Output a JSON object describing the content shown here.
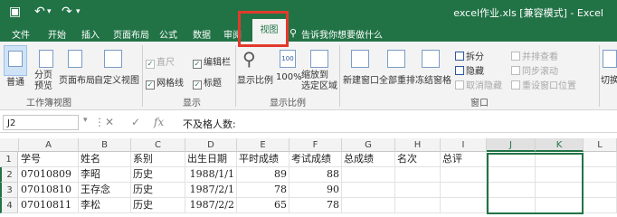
{
  "titlebar": {
    "title": "excel作业.xls [兼容模式] - Excel",
    "qat": [
      "save-icon",
      "undo-icon",
      "redo-icon",
      "customize-icon"
    ]
  },
  "tabs": [
    "文件",
    "开始",
    "插入",
    "页面布局",
    "公式",
    "数据",
    "审阅",
    "视图"
  ],
  "active_tab": "视图",
  "tell_me": "告诉我你想要做什么",
  "ribbon": {
    "workbook_views": {
      "normal": "普通",
      "page_break": "分页\n预览",
      "page_layout": "页面布局",
      "custom": "自定义视图",
      "group": "工作簿视图"
    },
    "show": {
      "ruler": "直尺",
      "formula_bar": "编辑栏",
      "gridlines": "网格线",
      "headings": "标题",
      "group": "显示"
    },
    "zoom": {
      "zoom": "显示比例",
      "zoom100": "100%",
      "zoom_selection": "缩放到\n选定区域",
      "group": "显示比例"
    },
    "window": {
      "new_window": "新建窗口",
      "arrange_all": "全部重排",
      "freeze": "冻结窗格",
      "split": "拆分",
      "hide": "隐藏",
      "unhide": "取消隐藏",
      "side_by_side": "并排查看",
      "sync_scroll": "同步滚动",
      "reset_pos": "重设窗口位置",
      "switch": "切换窗口",
      "group": "窗口"
    }
  },
  "formula_bar": {
    "name_box": "J2",
    "content": "不及格人数:"
  },
  "columns": [
    "A",
    "B",
    "C",
    "D",
    "E",
    "F",
    "G",
    "H",
    "I",
    "J",
    "K",
    "L"
  ],
  "rows": [
    {
      "num": "1",
      "cells": [
        "学号",
        "姓名",
        "系别",
        "出生日期",
        "平时成绩",
        "考试成绩",
        "总成绩",
        "名次",
        "总评",
        "",
        "",
        ""
      ]
    },
    {
      "num": "2",
      "cells": [
        "07010809",
        "李昭",
        "历史",
        "1988/1/1",
        "89",
        "88",
        "",
        "",
        "",
        "",
        "",
        ""
      ]
    },
    {
      "num": "3",
      "cells": [
        "07010810",
        "王存念",
        "历史",
        "1987/2/1",
        "78",
        "90",
        "",
        "",
        "",
        "",
        "",
        ""
      ]
    },
    {
      "num": "4",
      "cells": [
        "07010811",
        "李松",
        "历史",
        "1987/2/2",
        "65",
        "78",
        "",
        "",
        "",
        "",
        "",
        ""
      ]
    }
  ]
}
